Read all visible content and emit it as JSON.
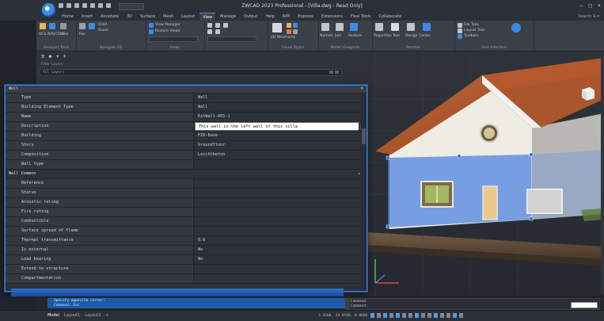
{
  "titlebar": {
    "title": "ZWCAD 2023 Professional - [Villa.dwg - Read Only]",
    "workspace": "2D Drafting",
    "controls": [
      "–",
      "□",
      "×"
    ]
  },
  "ribbon": {
    "tabs": [
      "Home",
      "Insert",
      "Annotate",
      "3D",
      "Surface",
      "Mesh",
      "Layout",
      "View",
      "Manage",
      "Output",
      "Help",
      "APP",
      "Express",
      "Extensions",
      "Flexi Tools",
      "Collaborate"
    ],
    "active_tab": "View",
    "right_label": "Search & ▾",
    "groups": [
      {
        "label": "Viewport Tools",
        "items": [
          "UCS",
          "NAVCUBE",
          "Bar"
        ]
      },
      {
        "label": "Navigate 2D",
        "items": [
          "Pan",
          "Orbit",
          "Zoom"
        ]
      },
      {
        "label": "Views",
        "items": [
          "View Manager",
          "Restore Views"
        ]
      },
      {
        "label": "Visual Styles",
        "items": [
          "2D Wireframe"
        ]
      },
      {
        "label": "Model Viewports",
        "items": [
          "Named",
          "Join",
          "Restore"
        ]
      },
      {
        "label": "Palettes",
        "items": [
          "Properties",
          "Tool",
          "Design Center"
        ]
      },
      {
        "label": "User Interface",
        "items": [
          "File Tabs",
          "Layout Tabs",
          "Toolbars"
        ]
      }
    ]
  },
  "browser": {
    "filter_label": "Filter Layers",
    "search_value": "All Layers"
  },
  "palette": {
    "title": "Wall",
    "close": "×",
    "rows": [
      {
        "name": "Type",
        "value": "Wall",
        "kind": "prop"
      },
      {
        "name": "Building Element Type",
        "value": "Wall",
        "kind": "prop"
      },
      {
        "name": "Name",
        "value": "ExtWall-001-1",
        "kind": "prop"
      },
      {
        "name": "Description",
        "value": "This wall is the left wall of this villa",
        "kind": "editing"
      },
      {
        "name": "Building",
        "value": "FIR-Base",
        "kind": "prop"
      },
      {
        "name": "Story",
        "value": "Groundfloor",
        "kind": "prop"
      },
      {
        "name": "Composition",
        "value": "Leichtbeton",
        "kind": "prop"
      },
      {
        "name": "Wall type",
        "value": "",
        "kind": "prop"
      },
      {
        "name": "Wall Common",
        "value": "",
        "kind": "section"
      },
      {
        "name": "Reference",
        "value": "",
        "kind": "prop"
      },
      {
        "name": "Status",
        "value": "",
        "kind": "prop"
      },
      {
        "name": "Acoustic rating",
        "value": "",
        "kind": "prop"
      },
      {
        "name": "Fire rating",
        "value": "",
        "kind": "prop"
      },
      {
        "name": "Combustible",
        "value": "",
        "kind": "prop"
      },
      {
        "name": "Surface spread of flame",
        "value": "",
        "kind": "prop"
      },
      {
        "name": "Thermal transmittance",
        "value": "0.6",
        "kind": "prop"
      },
      {
        "name": "Is external",
        "value": "No",
        "kind": "prop"
      },
      {
        "name": "Load bearing",
        "value": "No",
        "kind": "prop"
      },
      {
        "name": "Extend to structure",
        "value": "",
        "kind": "prop"
      },
      {
        "name": "Compartmentation",
        "value": "",
        "kind": "prop"
      }
    ]
  },
  "commandline": {
    "history": [
      "Specify opposite corner:",
      "Command: Esc"
    ],
    "prompt_lines": [
      "Command:",
      "Command:"
    ]
  },
  "status": {
    "model_tab": "Model",
    "layout_tabs": [
      "Layout1",
      "Layout2"
    ],
    "add": "+",
    "coords": "3.2600, 34.8500, 0.0000"
  },
  "colors": {
    "accent": "#3d7fd6",
    "wall_highlight": "#4a7fe0",
    "roof": "#b35b2a",
    "house_wall": "#f0ece6"
  }
}
